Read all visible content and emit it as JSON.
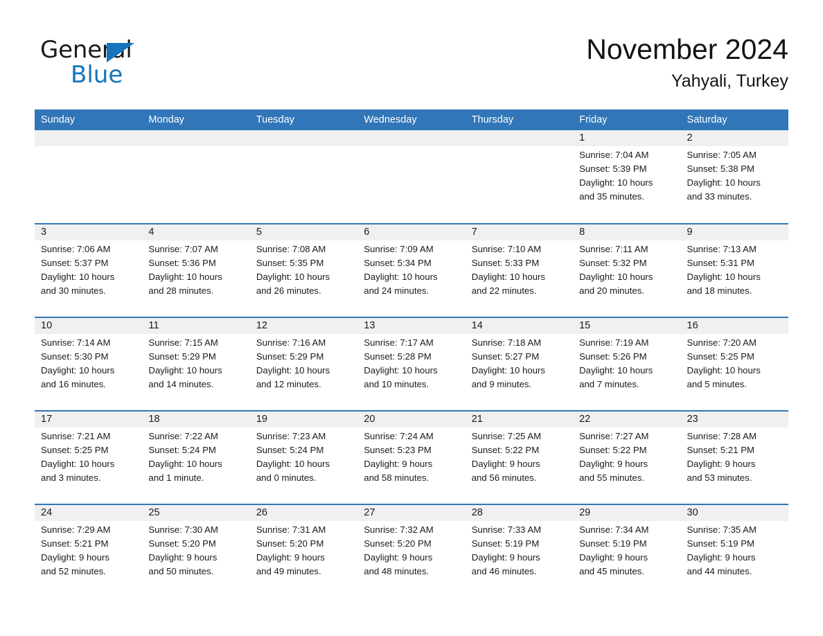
{
  "brand": {
    "name_part1": "General",
    "name_part2": "Blue",
    "triangle_color": "#1574bd"
  },
  "header": {
    "title": "November 2024",
    "subtitle": "Yahyali, Turkey",
    "header_bg_color": "#3176b8",
    "date_band_color": "#f0f0f0"
  },
  "weekdays": [
    "Sunday",
    "Monday",
    "Tuesday",
    "Wednesday",
    "Thursday",
    "Friday",
    "Saturday"
  ],
  "weeks": [
    [
      {
        "day": "",
        "sunrise": "",
        "sunset": "",
        "daylight_line1": "",
        "daylight_line2": ""
      },
      {
        "day": "",
        "sunrise": "",
        "sunset": "",
        "daylight_line1": "",
        "daylight_line2": ""
      },
      {
        "day": "",
        "sunrise": "",
        "sunset": "",
        "daylight_line1": "",
        "daylight_line2": ""
      },
      {
        "day": "",
        "sunrise": "",
        "sunset": "",
        "daylight_line1": "",
        "daylight_line2": ""
      },
      {
        "day": "",
        "sunrise": "",
        "sunset": "",
        "daylight_line1": "",
        "daylight_line2": ""
      },
      {
        "day": "1",
        "sunrise": "Sunrise: 7:04 AM",
        "sunset": "Sunset: 5:39 PM",
        "daylight_line1": "Daylight: 10 hours",
        "daylight_line2": "and 35 minutes."
      },
      {
        "day": "2",
        "sunrise": "Sunrise: 7:05 AM",
        "sunset": "Sunset: 5:38 PM",
        "daylight_line1": "Daylight: 10 hours",
        "daylight_line2": "and 33 minutes."
      }
    ],
    [
      {
        "day": "3",
        "sunrise": "Sunrise: 7:06 AM",
        "sunset": "Sunset: 5:37 PM",
        "daylight_line1": "Daylight: 10 hours",
        "daylight_line2": "and 30 minutes."
      },
      {
        "day": "4",
        "sunrise": "Sunrise: 7:07 AM",
        "sunset": "Sunset: 5:36 PM",
        "daylight_line1": "Daylight: 10 hours",
        "daylight_line2": "and 28 minutes."
      },
      {
        "day": "5",
        "sunrise": "Sunrise: 7:08 AM",
        "sunset": "Sunset: 5:35 PM",
        "daylight_line1": "Daylight: 10 hours",
        "daylight_line2": "and 26 minutes."
      },
      {
        "day": "6",
        "sunrise": "Sunrise: 7:09 AM",
        "sunset": "Sunset: 5:34 PM",
        "daylight_line1": "Daylight: 10 hours",
        "daylight_line2": "and 24 minutes."
      },
      {
        "day": "7",
        "sunrise": "Sunrise: 7:10 AM",
        "sunset": "Sunset: 5:33 PM",
        "daylight_line1": "Daylight: 10 hours",
        "daylight_line2": "and 22 minutes."
      },
      {
        "day": "8",
        "sunrise": "Sunrise: 7:11 AM",
        "sunset": "Sunset: 5:32 PM",
        "daylight_line1": "Daylight: 10 hours",
        "daylight_line2": "and 20 minutes."
      },
      {
        "day": "9",
        "sunrise": "Sunrise: 7:13 AM",
        "sunset": "Sunset: 5:31 PM",
        "daylight_line1": "Daylight: 10 hours",
        "daylight_line2": "and 18 minutes."
      }
    ],
    [
      {
        "day": "10",
        "sunrise": "Sunrise: 7:14 AM",
        "sunset": "Sunset: 5:30 PM",
        "daylight_line1": "Daylight: 10 hours",
        "daylight_line2": "and 16 minutes."
      },
      {
        "day": "11",
        "sunrise": "Sunrise: 7:15 AM",
        "sunset": "Sunset: 5:29 PM",
        "daylight_line1": "Daylight: 10 hours",
        "daylight_line2": "and 14 minutes."
      },
      {
        "day": "12",
        "sunrise": "Sunrise: 7:16 AM",
        "sunset": "Sunset: 5:29 PM",
        "daylight_line1": "Daylight: 10 hours",
        "daylight_line2": "and 12 minutes."
      },
      {
        "day": "13",
        "sunrise": "Sunrise: 7:17 AM",
        "sunset": "Sunset: 5:28 PM",
        "daylight_line1": "Daylight: 10 hours",
        "daylight_line2": "and 10 minutes."
      },
      {
        "day": "14",
        "sunrise": "Sunrise: 7:18 AM",
        "sunset": "Sunset: 5:27 PM",
        "daylight_line1": "Daylight: 10 hours",
        "daylight_line2": "and 9 minutes."
      },
      {
        "day": "15",
        "sunrise": "Sunrise: 7:19 AM",
        "sunset": "Sunset: 5:26 PM",
        "daylight_line1": "Daylight: 10 hours",
        "daylight_line2": "and 7 minutes."
      },
      {
        "day": "16",
        "sunrise": "Sunrise: 7:20 AM",
        "sunset": "Sunset: 5:25 PM",
        "daylight_line1": "Daylight: 10 hours",
        "daylight_line2": "and 5 minutes."
      }
    ],
    [
      {
        "day": "17",
        "sunrise": "Sunrise: 7:21 AM",
        "sunset": "Sunset: 5:25 PM",
        "daylight_line1": "Daylight: 10 hours",
        "daylight_line2": "and 3 minutes."
      },
      {
        "day": "18",
        "sunrise": "Sunrise: 7:22 AM",
        "sunset": "Sunset: 5:24 PM",
        "daylight_line1": "Daylight: 10 hours",
        "daylight_line2": "and 1 minute."
      },
      {
        "day": "19",
        "sunrise": "Sunrise: 7:23 AM",
        "sunset": "Sunset: 5:24 PM",
        "daylight_line1": "Daylight: 10 hours",
        "daylight_line2": "and 0 minutes."
      },
      {
        "day": "20",
        "sunrise": "Sunrise: 7:24 AM",
        "sunset": "Sunset: 5:23 PM",
        "daylight_line1": "Daylight: 9 hours",
        "daylight_line2": "and 58 minutes."
      },
      {
        "day": "21",
        "sunrise": "Sunrise: 7:25 AM",
        "sunset": "Sunset: 5:22 PM",
        "daylight_line1": "Daylight: 9 hours",
        "daylight_line2": "and 56 minutes."
      },
      {
        "day": "22",
        "sunrise": "Sunrise: 7:27 AM",
        "sunset": "Sunset: 5:22 PM",
        "daylight_line1": "Daylight: 9 hours",
        "daylight_line2": "and 55 minutes."
      },
      {
        "day": "23",
        "sunrise": "Sunrise: 7:28 AM",
        "sunset": "Sunset: 5:21 PM",
        "daylight_line1": "Daylight: 9 hours",
        "daylight_line2": "and 53 minutes."
      }
    ],
    [
      {
        "day": "24",
        "sunrise": "Sunrise: 7:29 AM",
        "sunset": "Sunset: 5:21 PM",
        "daylight_line1": "Daylight: 9 hours",
        "daylight_line2": "and 52 minutes."
      },
      {
        "day": "25",
        "sunrise": "Sunrise: 7:30 AM",
        "sunset": "Sunset: 5:20 PM",
        "daylight_line1": "Daylight: 9 hours",
        "daylight_line2": "and 50 minutes."
      },
      {
        "day": "26",
        "sunrise": "Sunrise: 7:31 AM",
        "sunset": "Sunset: 5:20 PM",
        "daylight_line1": "Daylight: 9 hours",
        "daylight_line2": "and 49 minutes."
      },
      {
        "day": "27",
        "sunrise": "Sunrise: 7:32 AM",
        "sunset": "Sunset: 5:20 PM",
        "daylight_line1": "Daylight: 9 hours",
        "daylight_line2": "and 48 minutes."
      },
      {
        "day": "28",
        "sunrise": "Sunrise: 7:33 AM",
        "sunset": "Sunset: 5:19 PM",
        "daylight_line1": "Daylight: 9 hours",
        "daylight_line2": "and 46 minutes."
      },
      {
        "day": "29",
        "sunrise": "Sunrise: 7:34 AM",
        "sunset": "Sunset: 5:19 PM",
        "daylight_line1": "Daylight: 9 hours",
        "daylight_line2": "and 45 minutes."
      },
      {
        "day": "30",
        "sunrise": "Sunrise: 7:35 AM",
        "sunset": "Sunset: 5:19 PM",
        "daylight_line1": "Daylight: 9 hours",
        "daylight_line2": "and 44 minutes."
      }
    ]
  ]
}
